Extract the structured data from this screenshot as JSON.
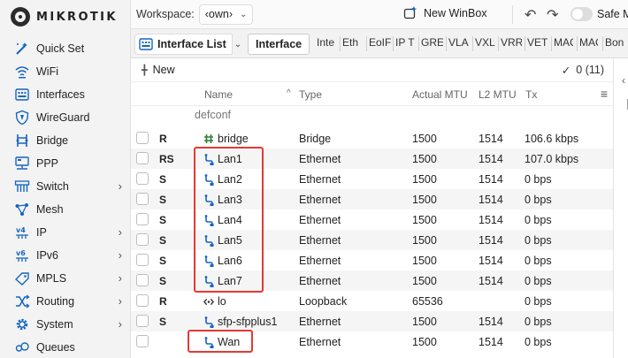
{
  "brand": {
    "logo_text": "MIKROTIK"
  },
  "sidebar": {
    "items": [
      {
        "label": "Quick Set",
        "icon": "wand-icon",
        "has_submenu": false
      },
      {
        "label": "WiFi",
        "icon": "wifi-icon",
        "has_submenu": false
      },
      {
        "label": "Interfaces",
        "icon": "interfaces-icon",
        "has_submenu": false
      },
      {
        "label": "WireGuard",
        "icon": "wireguard-icon",
        "has_submenu": false
      },
      {
        "label": "Bridge",
        "icon": "bridge-icon",
        "has_submenu": false
      },
      {
        "label": "PPP",
        "icon": "ppp-icon",
        "has_submenu": false
      },
      {
        "label": "Switch",
        "icon": "switch-icon",
        "has_submenu": true
      },
      {
        "label": "Mesh",
        "icon": "mesh-icon",
        "has_submenu": false
      },
      {
        "label": "IP",
        "icon": "ip-icon",
        "has_submenu": true
      },
      {
        "label": "IPv6",
        "icon": "ipv6-icon",
        "has_submenu": true
      },
      {
        "label": "MPLS",
        "icon": "mpls-icon",
        "has_submenu": true
      },
      {
        "label": "Routing",
        "icon": "routing-icon",
        "has_submenu": true
      },
      {
        "label": "System",
        "icon": "gear-icon",
        "has_submenu": true
      },
      {
        "label": "Queues",
        "icon": "queues-icon",
        "has_submenu": false
      }
    ]
  },
  "topbar": {
    "workspace_label": "Workspace:",
    "workspace_value": "‹own›",
    "new_winbox": "New WinBox",
    "safe_mode": "Safe Mode"
  },
  "tabs": {
    "list_title": "Interface List",
    "active": "Interface",
    "others": [
      "Interface List",
      "Ethernet",
      "EoIP Tunnel",
      "IP Tunnel",
      "GRE Tunnel",
      "VLAN",
      "VXLAN",
      "VRRP",
      "VETH",
      "MACVLAN",
      "MACsec",
      "Bonding"
    ],
    "visible": [
      "Inte",
      "Eth",
      "EoIF",
      "IP T",
      "GRE",
      "VLA",
      "VXL",
      "VRR",
      "VET",
      "MAC",
      "MAC",
      "Bon"
    ]
  },
  "actions": {
    "new_label": "New",
    "count": "0 (11)"
  },
  "table": {
    "columns": {
      "name": "Name",
      "type": "Type",
      "actual_mtu": "Actual MTU",
      "l2_mtu": "L2 MTU",
      "tx": "Tx"
    },
    "group_label": "defconf",
    "rows": [
      {
        "flags": "R",
        "name": "bridge",
        "icon": "bridge",
        "type": "Bridge",
        "actual_mtu": "1500",
        "l2_mtu": "1514",
        "tx": "106.6 kbps"
      },
      {
        "flags": "RS",
        "name": "Lan1",
        "icon": "ethernet",
        "type": "Ethernet",
        "actual_mtu": "1500",
        "l2_mtu": "1514",
        "tx": "107.0 kbps"
      },
      {
        "flags": "S",
        "name": "Lan2",
        "icon": "ethernet",
        "type": "Ethernet",
        "actual_mtu": "1500",
        "l2_mtu": "1514",
        "tx": "0 bps"
      },
      {
        "flags": "S",
        "name": "Lan3",
        "icon": "ethernet",
        "type": "Ethernet",
        "actual_mtu": "1500",
        "l2_mtu": "1514",
        "tx": "0 bps"
      },
      {
        "flags": "S",
        "name": "Lan4",
        "icon": "ethernet",
        "type": "Ethernet",
        "actual_mtu": "1500",
        "l2_mtu": "1514",
        "tx": "0 bps"
      },
      {
        "flags": "S",
        "name": "Lan5",
        "icon": "ethernet",
        "type": "Ethernet",
        "actual_mtu": "1500",
        "l2_mtu": "1514",
        "tx": "0 bps"
      },
      {
        "flags": "S",
        "name": "Lan6",
        "icon": "ethernet",
        "type": "Ethernet",
        "actual_mtu": "1500",
        "l2_mtu": "1514",
        "tx": "0 bps"
      },
      {
        "flags": "S",
        "name": "Lan7",
        "icon": "ethernet",
        "type": "Ethernet",
        "actual_mtu": "1500",
        "l2_mtu": "1514",
        "tx": "0 bps"
      },
      {
        "flags": "R",
        "name": "lo",
        "icon": "loopback",
        "type": "Loopback",
        "actual_mtu": "65536",
        "l2_mtu": "",
        "tx": "0 bps"
      },
      {
        "flags": "S",
        "name": "sfp-sfpplus1",
        "icon": "ethernet",
        "type": "Ethernet",
        "actual_mtu": "1500",
        "l2_mtu": "1514",
        "tx": "0 bps"
      },
      {
        "flags": "",
        "name": "Wan",
        "icon": "ethernet",
        "type": "Ethernet",
        "actual_mtu": "1500",
        "l2_mtu": "1514",
        "tx": "0 bps"
      }
    ]
  },
  "colors": {
    "accent": "#1565c0",
    "highlight": "#e53935",
    "bridge_icon": "#2e7d32"
  }
}
